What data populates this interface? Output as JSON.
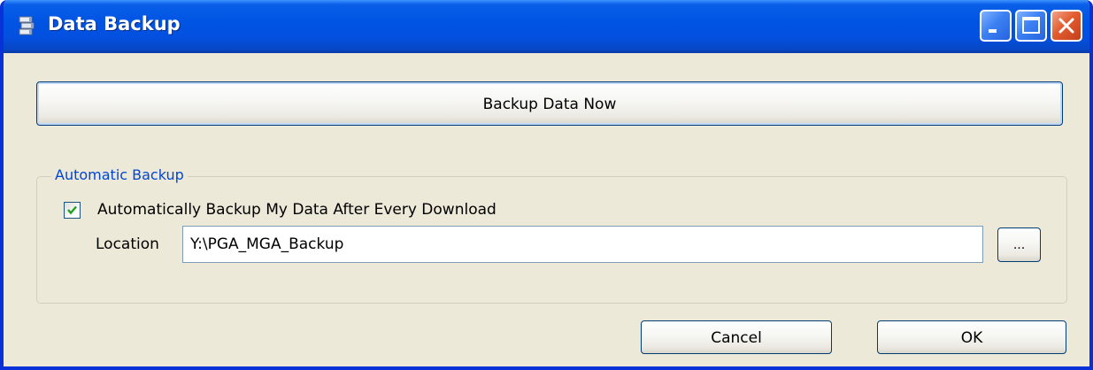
{
  "window": {
    "title": "Data Backup",
    "app_icon": "data-backup-app-icon",
    "controls": {
      "minimize_icon": "minimize-icon",
      "maximize_icon": "maximize-icon",
      "close_icon": "close-icon"
    }
  },
  "actions": {
    "backup_now_label": "Backup Data Now"
  },
  "automatic_backup": {
    "group_label": "Automatic Backup",
    "checkbox_label": "Automatically Backup My Data After Every Download",
    "checkbox_checked": true,
    "location_label": "Location",
    "location_value": "Y:\\PGA_MGA_Backup",
    "browse_label": "..."
  },
  "footer": {
    "cancel_label": "Cancel",
    "ok_label": "OK"
  },
  "colors": {
    "titlebar_blue": "#0054e3",
    "window_face": "#ece9d8",
    "group_label_blue": "#0046d5",
    "close_red": "#e35c2f",
    "check_green": "#21a121"
  }
}
